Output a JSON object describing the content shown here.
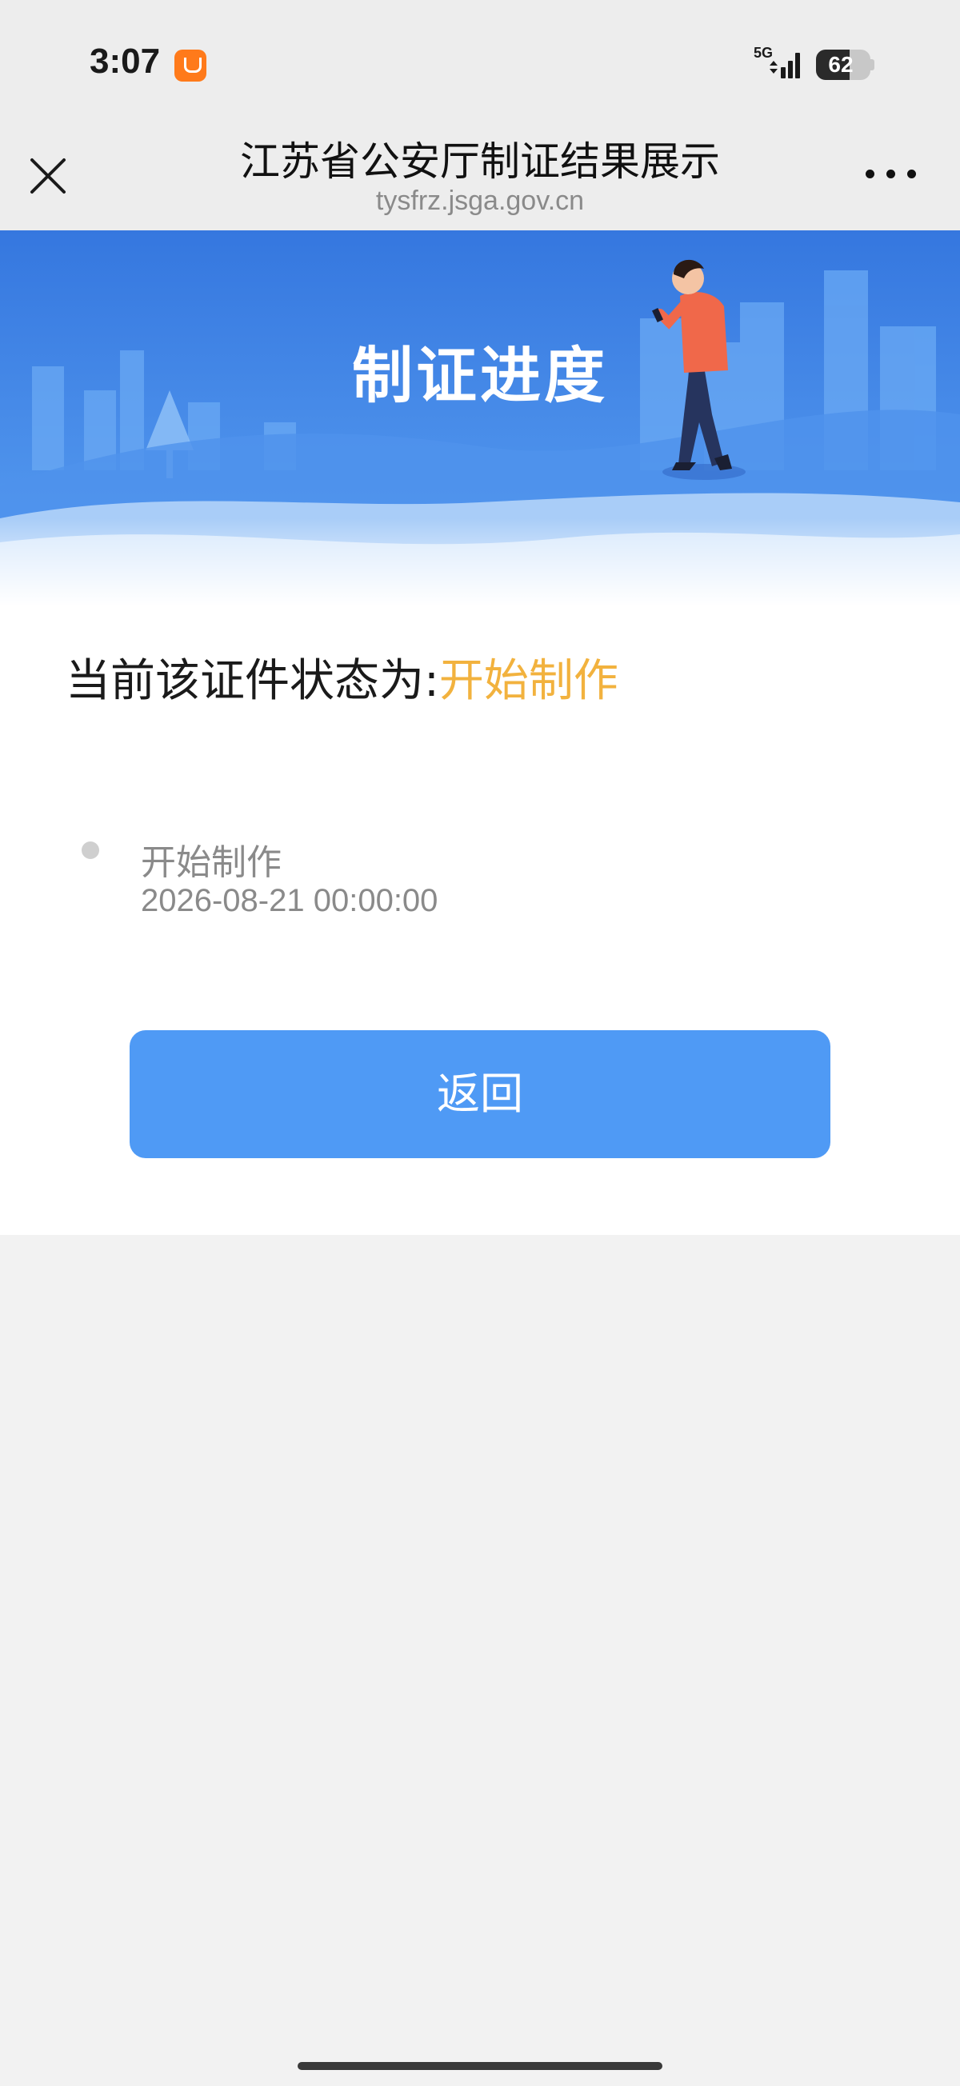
{
  "status_bar": {
    "time": "3:07",
    "network": "5G",
    "battery": "62",
    "battery_level": 0.62
  },
  "nav": {
    "title": "江苏省公安厅制证结果展示",
    "url": "tysfrz.jsga.gov.cn"
  },
  "banner": {
    "title": "制证进度"
  },
  "status": {
    "prefix": "当前该证件状态为:",
    "value": "开始制作"
  },
  "timeline": [
    {
      "label": "开始制作",
      "time": "2026-08-21 00:00:00"
    }
  ],
  "back_button_label": "返回",
  "colors": {
    "accent_blue": "#4f9af5",
    "status_yellow": "#f2b23e",
    "banner_blue": "#3a7fe0"
  }
}
